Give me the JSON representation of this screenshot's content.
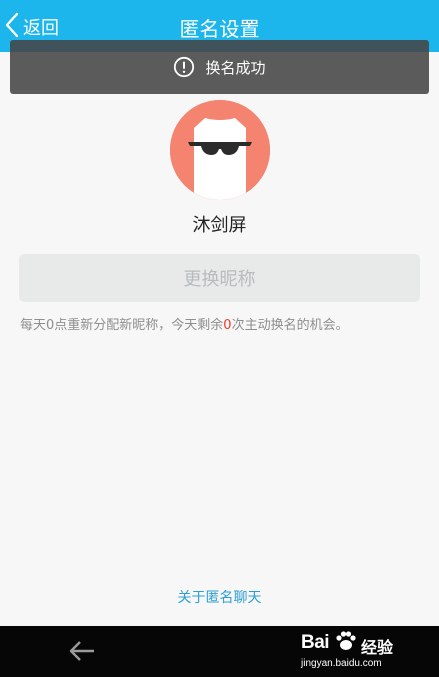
{
  "header": {
    "back_label": "返回",
    "title": "匿名设置",
    "background": "#1cb6ec"
  },
  "toast": {
    "icon": "alert-circle-icon",
    "message": "换名成功"
  },
  "profile": {
    "avatar": "sunglasses-cat-avatar",
    "avatar_color": "#f48370",
    "nickname": "沐剑屏"
  },
  "change_button": {
    "label": "更换昵称"
  },
  "hint": {
    "prefix": "每天0点重新分配新昵称，今天剩余",
    "count": "0",
    "suffix": "次主动换名的机会。",
    "highlight_color": "#ee3b2b"
  },
  "about_link": {
    "label": "关于匿名聊天"
  },
  "navbar": {
    "back_icon": "arrow-left-icon",
    "watermark_logo": "Bai",
    "watermark_label": "经验",
    "watermark_url": "jingyan.baidu.com"
  }
}
